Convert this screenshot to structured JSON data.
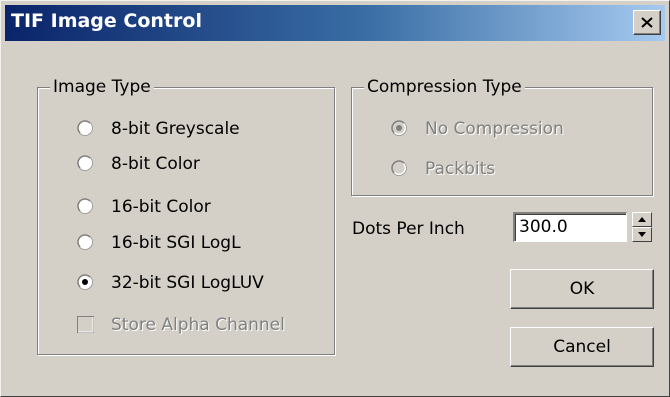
{
  "window": {
    "title": "TIF Image Control"
  },
  "image_type": {
    "legend": "Image Type",
    "options": [
      {
        "label": "8-bit Greyscale",
        "selected": false
      },
      {
        "label": "8-bit Color",
        "selected": false
      },
      {
        "label": "16-bit Color",
        "selected": false
      },
      {
        "label": "16-bit SGI LogL",
        "selected": false
      },
      {
        "label": "32-bit SGI LogLUV",
        "selected": true
      }
    ],
    "store_alpha": {
      "label": "Store Alpha Channel",
      "checked": false,
      "enabled": false
    }
  },
  "compression": {
    "legend": "Compression Type",
    "options": [
      {
        "label": "No Compression",
        "selected": true,
        "enabled": false
      },
      {
        "label": "Packbits",
        "selected": false,
        "enabled": false
      }
    ]
  },
  "dpi": {
    "label": "Dots Per Inch",
    "value": "300.0"
  },
  "buttons": {
    "ok": "OK",
    "cancel": "Cancel"
  }
}
